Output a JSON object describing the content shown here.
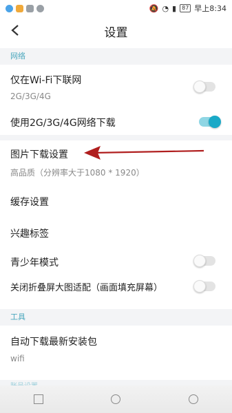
{
  "status_bar": {
    "battery": "87",
    "time": "早上8:34"
  },
  "header": {
    "title": "设置"
  },
  "sections": {
    "network": {
      "title": "网络",
      "wifi_only": {
        "label": "仅在Wi-Fi下联网",
        "sub": "2G/3G/4G",
        "toggle": false
      },
      "mobile_download": {
        "label": "使用2G/3G/4G网络下载",
        "toggle": true
      }
    },
    "general": {
      "image_download": {
        "label": "图片下载设置",
        "sub": "高品质（分辨率大于1080 * 1920）"
      },
      "cache": {
        "label": "缓存设置"
      },
      "interest_tags": {
        "label": "兴趣标签"
      },
      "teen_mode": {
        "label": "青少年模式",
        "toggle": false
      },
      "foldable_adapt": {
        "label": "关闭折叠屏大图适配（画面填充屏幕）",
        "toggle": false
      }
    },
    "tools": {
      "title": "工具",
      "auto_download": {
        "label": "自动下载最新安装包",
        "sub": "wifi"
      }
    },
    "next_section_partial": "账号设置"
  },
  "colors": {
    "accent": "#1aa9c7",
    "section_header_text": "#4aa7bd",
    "arrow": "#b01e1e"
  }
}
